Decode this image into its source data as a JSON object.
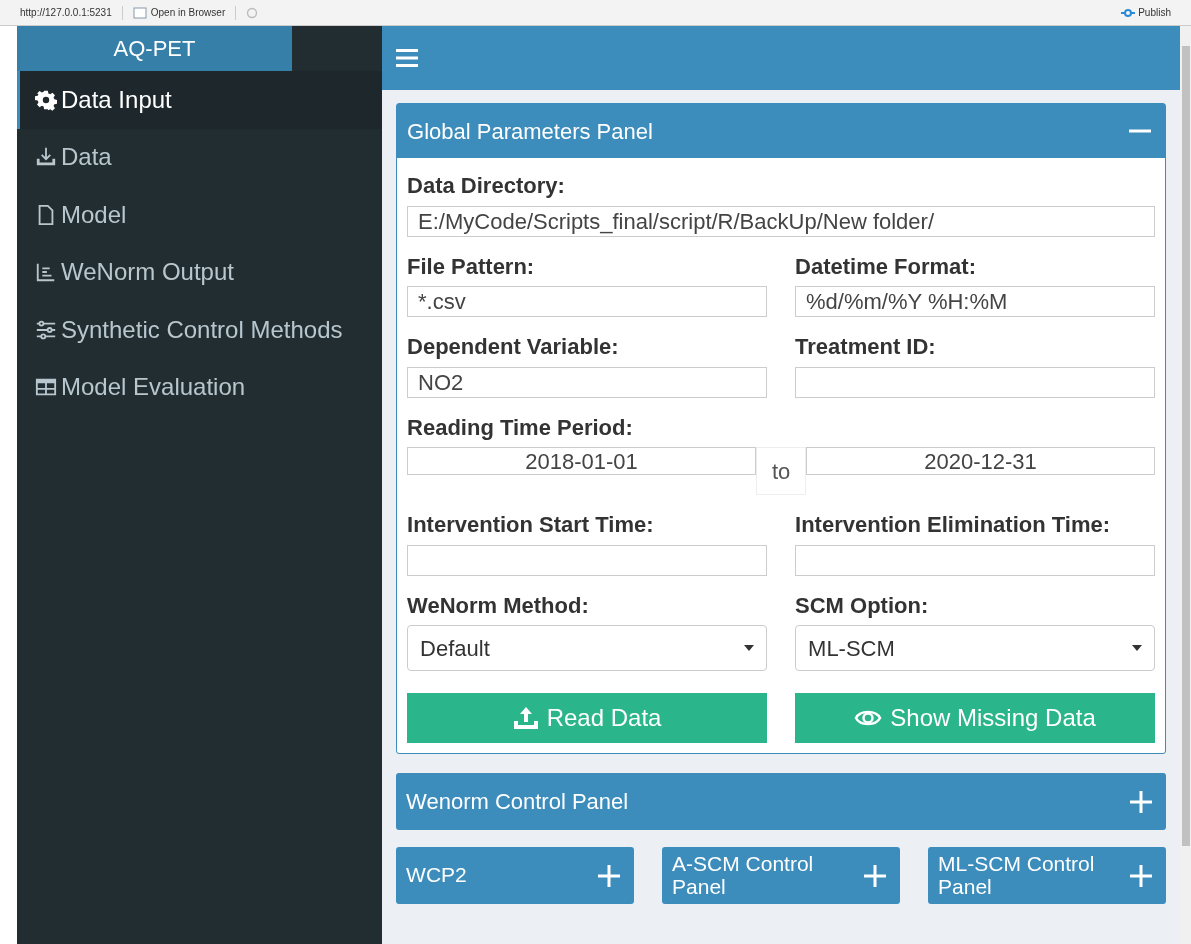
{
  "toolbar": {
    "url": "http://127.0.0.1:5231",
    "open_button": "Open in Browser",
    "publish_button": "Publish"
  },
  "sidebar": {
    "title": "AQ-PET",
    "items": [
      {
        "label": "Data Input",
        "selected": true
      },
      {
        "label": "Data",
        "selected": false
      },
      {
        "label": "Model",
        "selected": false
      },
      {
        "label": "WeNorm Output",
        "selected": false
      },
      {
        "label": "Synthetic Control Methods",
        "selected": false
      },
      {
        "label": "Model Evaluation",
        "selected": false
      }
    ]
  },
  "main_panel": {
    "title": "Global Parameters Panel",
    "expanded": true,
    "rows": [
      [
        {
          "kind": "text",
          "label": "Data Directory:",
          "value": "E:/MyCode/Scripts_final/script/R/BackUp/New folder/"
        }
      ],
      [
        {
          "kind": "text",
          "label": "File Pattern:",
          "value": "*.csv"
        },
        {
          "kind": "text",
          "label": "Datetime Format:",
          "value": "%d/%m/%Y %H:%M"
        }
      ],
      [
        {
          "kind": "text",
          "label": "Dependent Variable:",
          "value": "NO2"
        },
        {
          "kind": "text",
          "label": "Treatment ID:"
        }
      ],
      [
        {
          "kind": "daterange",
          "label": "Reading Time Period:",
          "start": "2018-01-01",
          "separator": "to",
          "end": "2020-12-31"
        }
      ],
      [
        {
          "kind": "text",
          "label": "Intervention Start Time:"
        },
        {
          "kind": "text",
          "label": "Intervention Elimination Time:"
        }
      ],
      [
        {
          "kind": "select",
          "label": "WeNorm Method:",
          "value": "Default"
        },
        {
          "kind": "select",
          "label": "SCM Option:",
          "value": "ML-SCM"
        }
      ]
    ],
    "buttons": [
      {
        "label": "Read Data",
        "kind": "upload"
      },
      {
        "label": "Show Missing Data",
        "kind": "eye"
      }
    ]
  },
  "wide_panels": [
    {
      "title": "Wenorm Control Panel",
      "expanded": false
    }
  ],
  "small_panels": [
    {
      "title": "WCP2",
      "expanded": false
    },
    {
      "title": "A-SCM Control Panel",
      "expanded": false
    },
    {
      "title": "ML-SCM Control Panel",
      "expanded": false
    }
  ]
}
